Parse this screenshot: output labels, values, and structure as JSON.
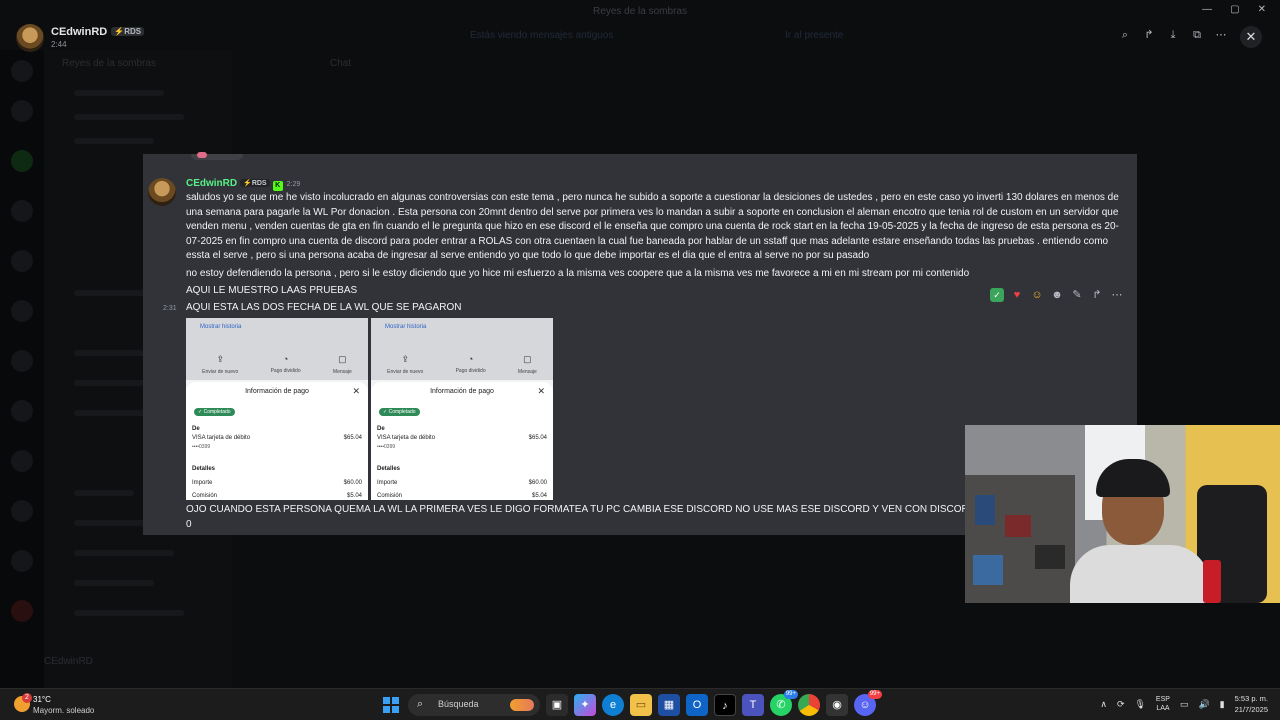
{
  "window": {
    "title": "Reyes de la sombras",
    "controls": [
      "—",
      "▢",
      "✕"
    ]
  },
  "background": {
    "server_name": "Reyes de la sombras",
    "channel": "Chat",
    "notice": "Estás viendo mensajes antiguos",
    "notice_action": "Ir al presente",
    "footer_user": "CEdwinRD"
  },
  "viewer": {
    "author": "CEdwinRD",
    "tag": "⚡RDS",
    "time": "2:44",
    "tools": [
      "zoom-icon",
      "forward-icon",
      "download-icon",
      "open-external-icon",
      "more-icon"
    ]
  },
  "message": {
    "author": "CEdwinRD",
    "tag": "⚡RDS",
    "badge": "K",
    "time": "2:29",
    "side_time": "2:31",
    "paragraph1": "saludos yo se que me he visto incolucrado en algunas controversias con este tema , pero nunca he subido a soporte a cuestionar la desiciones de ustedes , pero en este caso yo inverti 130  dolares en menos de una semana para pagarle la WL Por donacion . Esta persona con 20mnt dentro del serve por primera ves lo mandan a subir a soporte en conclusion el aleman encotro que tenia rol de custom en un servidor que venden menu , venden cuentas de gta en fin cuando el le pregunta que hizo en ese discord el le enseña que compro una cuenta de rock start en la fecha 19-05-2025  y la fecha de ingreso de esta persona es 20-07-2025 en fin compro una cuenta de discord para poder entrar a ROLAS con otra cuentaen la cual fue baneada por hablar de un sstaff que mas adelante estare enseñando todas las pruebas . entiendo como essta el serve , pero si una persona acaba de ingresar al serve entiendo yo que todo lo que debe importar es el dia que el entra al serve no por su pasado",
    "paragraph2": "no estoy defendiendo la persona , pero si le estoy diciendo que yo hice mi esfuerzo a la misma ves coopere que a la misma ves me favorece a mi en mi stream por  mi contenido",
    "line3": "AQUI LE MUESTRO LAAS PRUEBAS",
    "line4": "AQUI ESTA LAS DOS FECHA DE LA WL QUE SE PAGARON",
    "line5": "OJO CUANDO ESTA PERSONA QUEMA LA WL LA PRIMERA VES LE DIGO FORMATEA TU PC CAMBIA ESE DISCORD NO USE MAS ESE DISCORD Y  VEN CON DISCORD NUEVO",
    "line6": "0"
  },
  "hover_actions": {
    "check": "✓",
    "heart": "♥",
    "emoji": "☺",
    "add_reaction": "☻",
    "edit": "✎",
    "reply": "↱",
    "more": "⋯"
  },
  "receipts": [
    {
      "link": "Mostrar historia",
      "actions": [
        "Enviar de nuevo",
        "Pago dividido",
        "Mensaje"
      ],
      "sheet_title": "Información de pago",
      "status": "Completado",
      "de_label": "De",
      "method": "VISA tarjeta de débito",
      "method_amount": "$65.04",
      "card": "••••0399",
      "details_label": "Detalles",
      "importe_label": "Importe",
      "importe": "$60.00",
      "comision_label": "Comisión",
      "comision": "$5.04"
    },
    {
      "link": "Mostrar historia",
      "actions": [
        "Enviar de nuevo",
        "Pago dividido",
        "Mensaje"
      ],
      "sheet_title": "Información de pago",
      "status": "Completado",
      "de_label": "De",
      "method": "VISA tarjeta de débito",
      "method_amount": "$65.04",
      "card": "••••0399",
      "details_label": "Detalles",
      "importe_label": "Importe",
      "importe": "$60.00",
      "comision_label": "Comisión",
      "comision": "$5.04"
    }
  ],
  "taskbar": {
    "weather_badge": "2",
    "temperature": "31°C",
    "condition": "Mayorm. soleado",
    "search_placeholder": "Búsqueda",
    "whatsapp_badge": "99+",
    "discord_badge": "99+",
    "lang_top": "ESP",
    "lang_bottom": "LAA",
    "time": "5:53 p. m.",
    "date": "21/7/2025"
  }
}
